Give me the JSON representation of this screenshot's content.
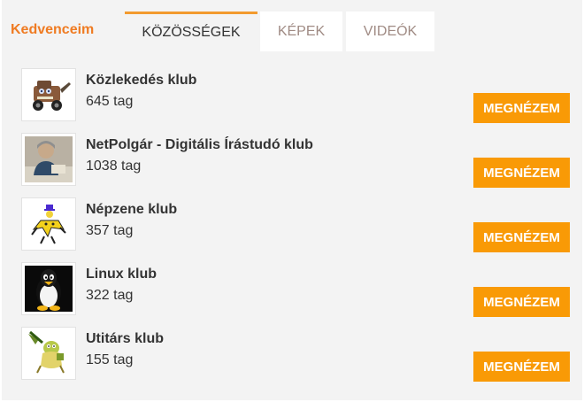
{
  "header": {
    "title": "Kedvenceim"
  },
  "tabs": [
    {
      "label": "KÖZÖSSÉGEK",
      "active": true
    },
    {
      "label": "KÉPEK",
      "active": false
    },
    {
      "label": "VIDEÓK",
      "active": false
    }
  ],
  "clubs": [
    {
      "title": "Közlekedés klub",
      "members": "645 tag",
      "button": "MEGNÉZEM",
      "icon": "tow-truck-cartoon-icon"
    },
    {
      "title": "NetPolgár - Digitális Írástudó klub",
      "members": "1038 tag",
      "button": "MEGNÉZEM",
      "icon": "person-photo-icon"
    },
    {
      "title": "Népzene klub",
      "members": "357 tag",
      "button": "MEGNÉZEM",
      "icon": "folk-dancer-figure-icon"
    },
    {
      "title": "Linux klub",
      "members": "322 tag",
      "button": "MEGNÉZEM",
      "icon": "tux-penguin-icon"
    },
    {
      "title": "Utitárs klub",
      "members": "155 tag",
      "button": "MEGNÉZEM",
      "icon": "traveler-creature-icon"
    }
  ],
  "colors": {
    "accent": "#ef7b22",
    "button": "#f99a06",
    "panel": "#f3f3f3"
  }
}
